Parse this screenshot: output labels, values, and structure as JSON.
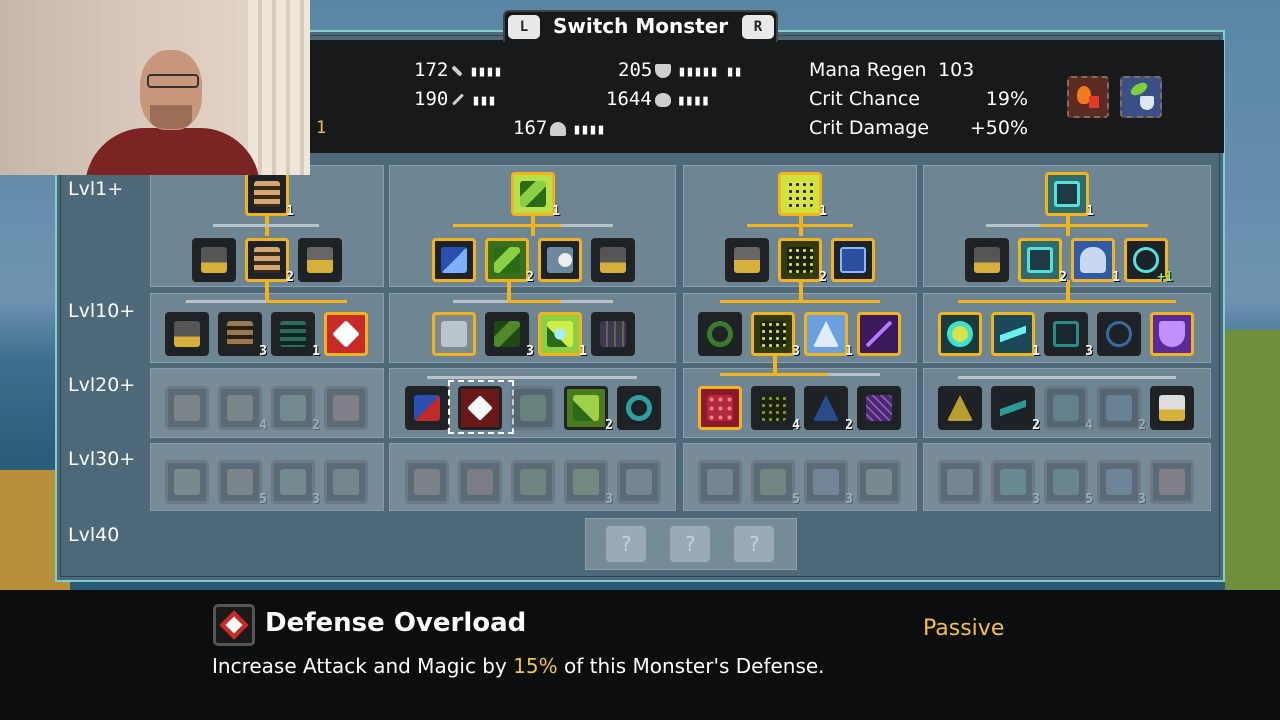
{
  "header": {
    "left_key": "L",
    "right_key": "R",
    "title": "Switch Monster",
    "level_hint": "1"
  },
  "stats": {
    "attack": "172",
    "magic": "190",
    "defense": "205",
    "health": "1644",
    "mana": "167",
    "mana_regen_label": "Mana Regen",
    "mana_regen_value": "103",
    "crit_chance_label": "Crit Chance",
    "crit_chance_value": "19%",
    "crit_damage_label": "Crit Damage",
    "crit_damage_value": "+50%"
  },
  "levels": [
    "Lvl1+",
    "Lvl10+",
    "Lvl20+",
    "Lvl30+",
    "Lvl40"
  ],
  "unknown_mark": "?",
  "badges": {
    "b1": "1",
    "b2": "2",
    "b3": "3",
    "b4": "4",
    "b5": "5",
    "plus1": "+1"
  },
  "selected_skill": {
    "name": "Defense Overload",
    "type": "Passive",
    "desc_prefix": "Increase Attack and Magic by",
    "desc_value": "15%",
    "desc_suffix": "of this Monster's Defense."
  },
  "colors": {
    "accent": "#f2b31b",
    "highlight": "#f3c23a",
    "panel": "#4e6a7a",
    "border": "#7fd0c8"
  }
}
